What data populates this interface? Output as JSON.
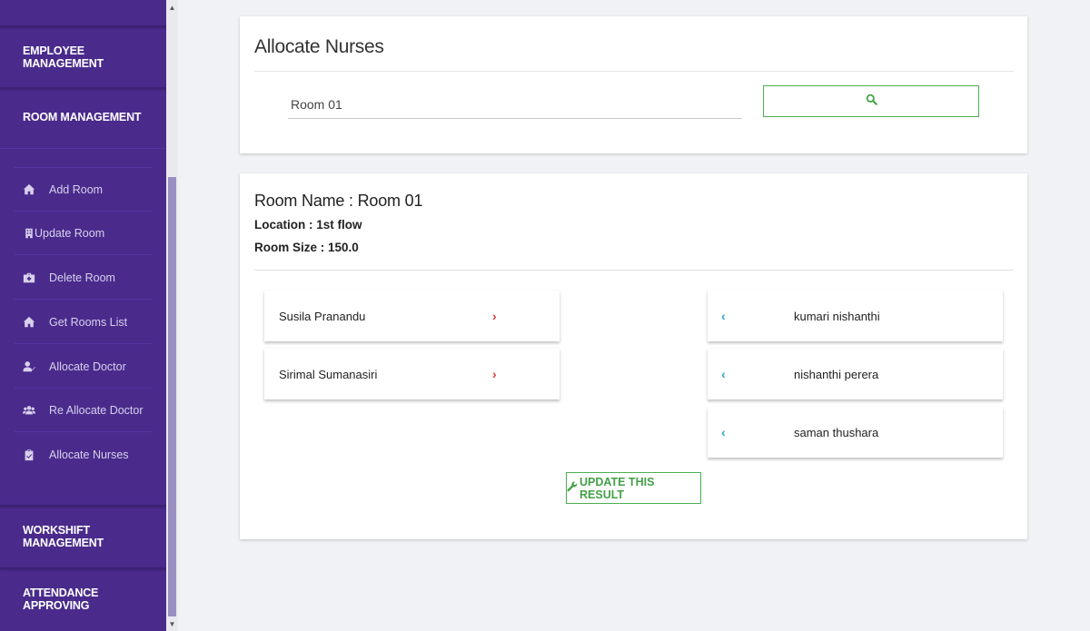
{
  "sidebar": {
    "sections": {
      "employee": "EMPLOYEE MANAGEMENT",
      "room": "ROOM MANAGEMENT",
      "workshift": "WORKSHIFT MANAGEMENT",
      "attendance": "ATTENDANCE APPROVING"
    },
    "items": [
      {
        "label": "Add Room",
        "icon": "home-icon"
      },
      {
        "label": "Update Room",
        "icon": "building-icon"
      },
      {
        "label": "Delete Room",
        "icon": "briefcase-medical-icon"
      },
      {
        "label": "Get Rooms List",
        "icon": "home-icon"
      },
      {
        "label": "Allocate Doctor",
        "icon": "user-check-icon"
      },
      {
        "label": "Re Allocate Doctor",
        "icon": "users-icon"
      },
      {
        "label": "Allocate Nurses",
        "icon": "clipboard-check-icon"
      }
    ]
  },
  "page": {
    "title": "Allocate Nurses",
    "search_value": "Room 01"
  },
  "room": {
    "name": "Room Name : Room 01",
    "location": "Location : 1st flow",
    "size": "Room Size : 150.0"
  },
  "allocated_nurses": [
    "Susila Pranandu",
    "Sirimal Sumanasiri"
  ],
  "available_nurses": [
    "kumari nishanthi",
    "nishanthi perera",
    "saman thushara"
  ],
  "arrows": {
    "right": "›",
    "left": "‹"
  },
  "update_button": "UPDATE THIS RESULT",
  "colors": {
    "sidebar": "#4a2b8c",
    "accent_green": "#4caf50",
    "remove_arrow": "#e53935",
    "add_arrow": "#26a6c9"
  }
}
